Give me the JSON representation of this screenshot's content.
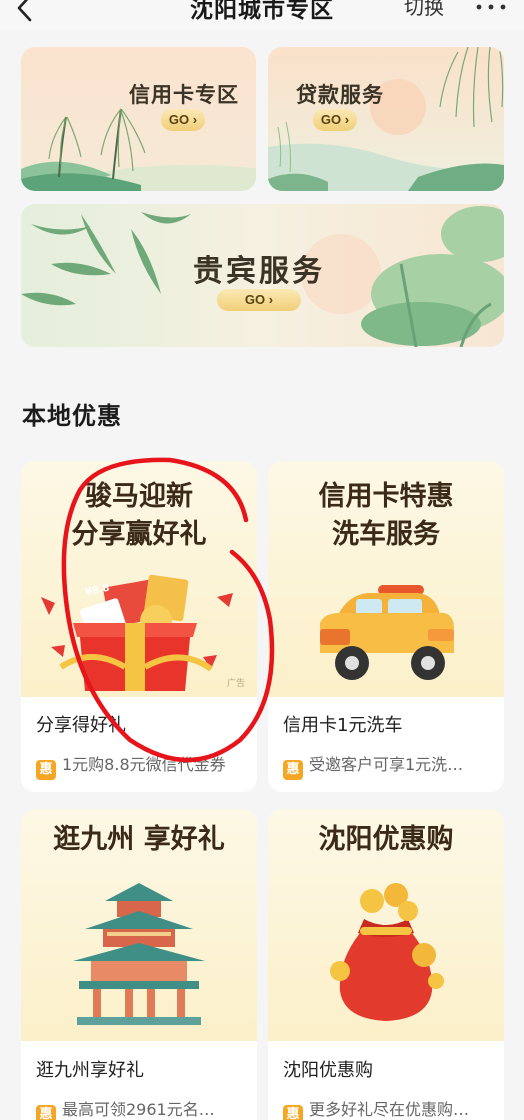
{
  "header": {
    "title": "沈阳城市专区",
    "switch_label": "切换"
  },
  "banners": {
    "credit_card": {
      "title": "信用卡专区",
      "go": "GO"
    },
    "loan": {
      "title": "贷款服务",
      "go": "GO"
    },
    "vip": {
      "title": "贵宾服务",
      "go": "GO"
    }
  },
  "section": {
    "title": "本地优惠"
  },
  "cards": [
    {
      "image_title_line1": "骏马迎新",
      "image_title_line2": "分享赢好礼",
      "name": "分享得好礼",
      "badge": "惠",
      "desc": "1元购8.8元微信代金券",
      "ad_tag": "广告",
      "coupon_text": "¥8.8"
    },
    {
      "image_title_line1": "信用卡特惠",
      "image_title_line2": "洗车服务",
      "name": "信用卡1元洗车",
      "badge": "惠",
      "desc": "受邀客户可享1元洗…"
    },
    {
      "image_title_line1": "逛九州 享好礼",
      "name": "逛九州享好礼",
      "badge": "惠",
      "desc": "最高可领2961元名…"
    },
    {
      "image_title_line1": "沈阳优惠购",
      "name": "沈阳优惠购",
      "badge": "惠",
      "desc": "更多好礼尽在优惠购…"
    }
  ],
  "colors": {
    "accent_gold": "#f1cf78",
    "badge_orange": "#f5a623",
    "annotation_red": "#e8141b"
  }
}
